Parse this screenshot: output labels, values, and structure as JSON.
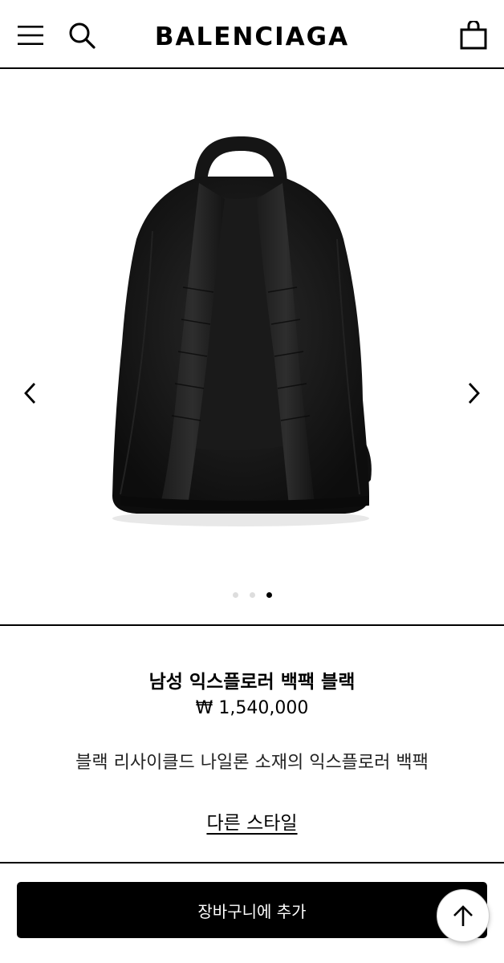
{
  "header": {
    "logo": "BALENCIAGA",
    "icons": {
      "menu": "hamburger-menu-icon",
      "search": "search-icon",
      "bag": "shopping-bag-icon"
    }
  },
  "gallery": {
    "image": "black-backpack-back-view",
    "total_slides": 3,
    "active_slide": 3,
    "icons": {
      "prev": "chevron-left-icon",
      "next": "chevron-right-icon"
    }
  },
  "product": {
    "title": "남성 익스플로러 백팩 블랙",
    "price": "₩ 1,540,000",
    "description": "블랙 리사이클드 나일론 소재의 익스플로러 백팩",
    "other_styles_label": "다른 스타일"
  },
  "actions": {
    "add_to_cart_label": "장바구니에 추가",
    "scroll_top_icon": "arrow-up-icon"
  },
  "colors": {
    "accent": "#000000",
    "background": "#ffffff"
  }
}
